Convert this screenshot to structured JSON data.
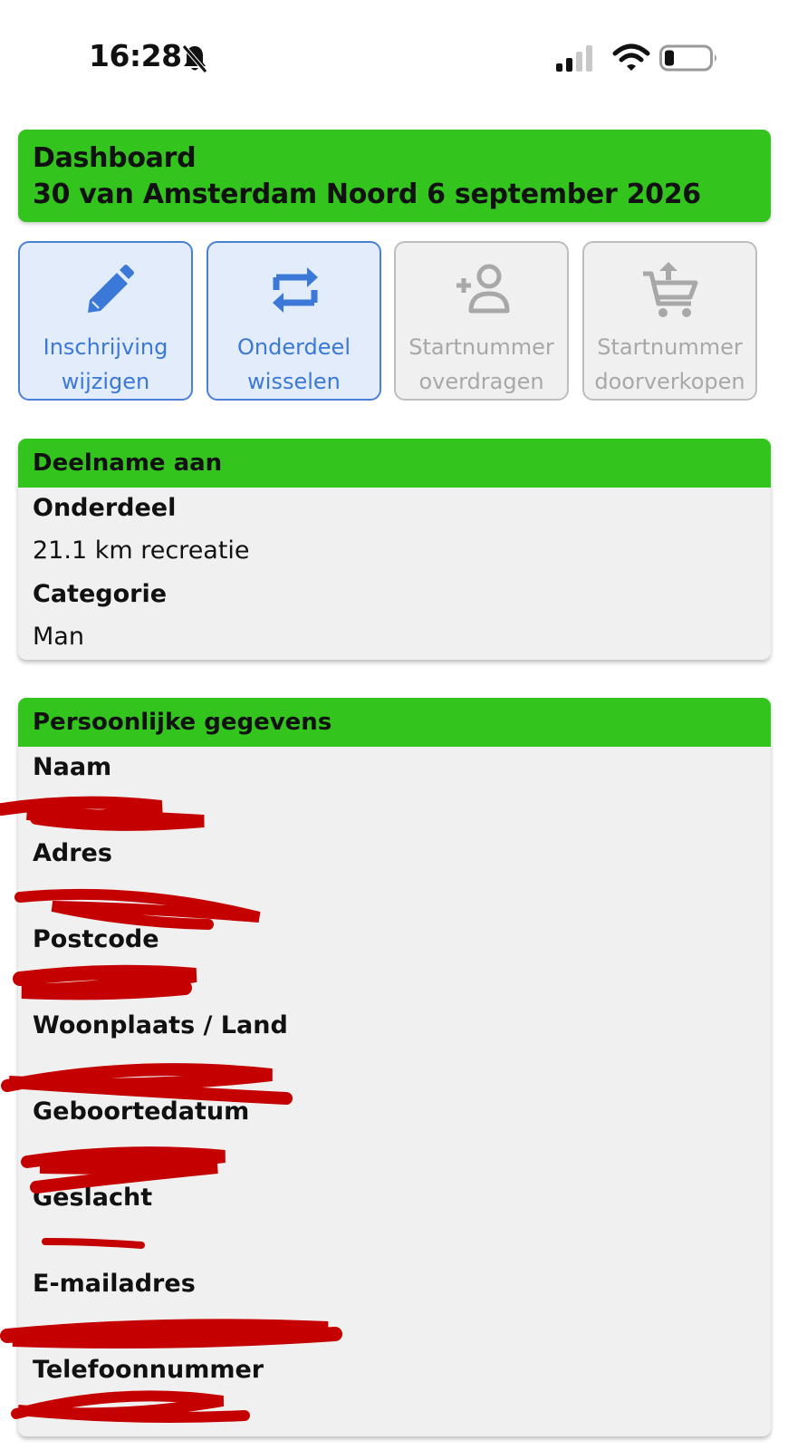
{
  "status_bar": {
    "time": "16:28",
    "icons": [
      "bell-slash-icon",
      "cellular-signal-icon",
      "wifi-icon",
      "battery-icon"
    ]
  },
  "header": {
    "title": "Dashboard",
    "subtitle": "30 van Amsterdam Noord 6 september 2026",
    "color": "#33c41e"
  },
  "actions": [
    {
      "label": "Inschrijving\nwijzigen",
      "icon": "pencil-icon",
      "enabled": true
    },
    {
      "label": "Onderdeel\nwisselen",
      "icon": "swap-icon",
      "enabled": true
    },
    {
      "label": "Startnummer\noverdragen",
      "icon": "add-person-icon",
      "enabled": false
    },
    {
      "label": "Startnummer\ndoorverkopen",
      "icon": "cart-upload-icon",
      "enabled": false
    }
  ],
  "participation": {
    "heading": "Deelname aan",
    "fields": [
      {
        "label": "Onderdeel",
        "value": "21.1 km recreatie"
      },
      {
        "label": "Categorie",
        "value": "Man"
      }
    ]
  },
  "personal": {
    "heading": "Persoonlijke gegevens",
    "fields": [
      {
        "label": "Naam",
        "value": ""
      },
      {
        "label": "Adres",
        "value": ""
      },
      {
        "label": "Postcode",
        "value": ""
      },
      {
        "label": "Woonplaats / Land",
        "value": ""
      },
      {
        "label": "Geboortedatum",
        "value": ""
      },
      {
        "label": "Geslacht",
        "value": ""
      },
      {
        "label": "E-mailadres",
        "value": ""
      },
      {
        "label": "Telefoonnummer",
        "value": ""
      }
    ]
  },
  "colors": {
    "accent_green": "#33c41e",
    "active_blue": "#3b78d8",
    "disabled_grey": "#a8a8a8",
    "redaction_red": "#c40000"
  }
}
